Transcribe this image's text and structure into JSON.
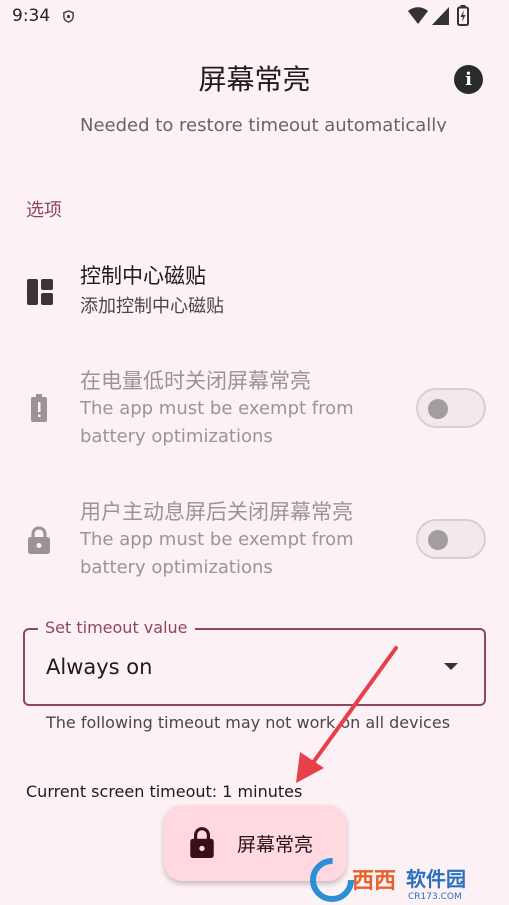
{
  "status_bar": {
    "time": "9:34"
  },
  "app_bar": {
    "title": "屏幕常亮"
  },
  "clipped_text": "Needed to restore timeout automatically",
  "section": {
    "header": "选项"
  },
  "tile": {
    "title": "控制中心磁贴",
    "subtitle": "添加控制中心磁贴"
  },
  "battery_option": {
    "title": "在电量低时关闭屏幕常亮",
    "subtitle_line1": "The app must be exempt from",
    "subtitle_line2": "battery optimizations",
    "enabled": false,
    "checked": false
  },
  "lock_option": {
    "title": "用户主动息屏后关闭屏幕常亮",
    "subtitle_line1": "The app must be exempt from",
    "subtitle_line2": "battery optimizations",
    "enabled": false,
    "checked": false
  },
  "timeout_select": {
    "label": "Set timeout value",
    "value": "Always on",
    "helper": "The following timeout may not work on all devices"
  },
  "current_timeout": "Current screen timeout: 1 minutes",
  "fab": {
    "label": "屏幕常亮"
  },
  "watermark": {
    "text": "西西软件园",
    "sub": "CR173.COM"
  },
  "colors": {
    "background": "#fcf1f4",
    "accent": "#8f4859",
    "fab_bg": "#ffd9df",
    "annotation": "#e8404a"
  },
  "icons": [
    "vpn-shield-icon",
    "wifi-icon",
    "signal-icon",
    "battery-charging-icon",
    "info-icon",
    "dashboard-tile-icon",
    "battery-alert-icon",
    "lock-icon",
    "dropdown-arrow-icon"
  ]
}
